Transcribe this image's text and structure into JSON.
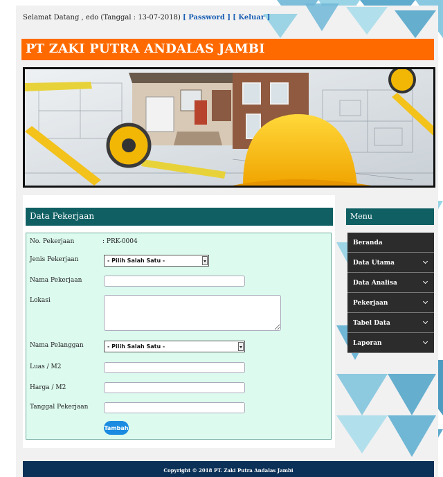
{
  "header": {
    "welcome_text": "Selamat Datang , edo (Tanggal : 13-07-2018)",
    "password_link": "[ Password ]",
    "logout_link": "[ Keluar ]",
    "company_title": "PT ZAKI PUTRA ANDALAS JAMBI"
  },
  "form": {
    "panel_title": "Data Pekerjaan",
    "fields": {
      "no_pekerjaan": {
        "label": "No. Pekerjaan",
        "value": ": PRK-0004"
      },
      "jenis_pekerjaan": {
        "label": "Jenis Pekerjaan",
        "selected": "- Pilih Salah Satu -"
      },
      "nama_pekerjaan": {
        "label": "Nama Pekerjaan",
        "value": ""
      },
      "lokasi": {
        "label": "Lokasi",
        "value": ""
      },
      "nama_pelanggan": {
        "label": "Nama Pelanggan",
        "selected": "- Pilih Salah Satu -"
      },
      "luas": {
        "label": "Luas / M2",
        "value": ""
      },
      "harga": {
        "label": "Harga / M2",
        "value": ""
      },
      "tanggal": {
        "label": "Tanggal Pekerjaan",
        "value": ""
      }
    },
    "submit_label": "Tambah"
  },
  "menu": {
    "title": "Menu",
    "items": [
      {
        "label": "Beranda",
        "has_submenu": false
      },
      {
        "label": "Data Utama",
        "has_submenu": true
      },
      {
        "label": "Data Analisa",
        "has_submenu": true
      },
      {
        "label": "Pekerjaan",
        "has_submenu": true
      },
      {
        "label": "Tabel Data",
        "has_submenu": true
      },
      {
        "label": "Laporan",
        "has_submenu": true
      }
    ]
  },
  "footer": {
    "copyright": "Copyright © 2018 PT. Zaki Putra Andalas Jambi"
  },
  "colors": {
    "title_bar": "#ff6a00",
    "panel_header": "#0f5f63",
    "form_bg": "#dcfaee",
    "menu_item_bg": "#2c2c2c",
    "footer_bg": "#0c3158",
    "button": "#1a8be0",
    "link": "#1a5fb4"
  }
}
